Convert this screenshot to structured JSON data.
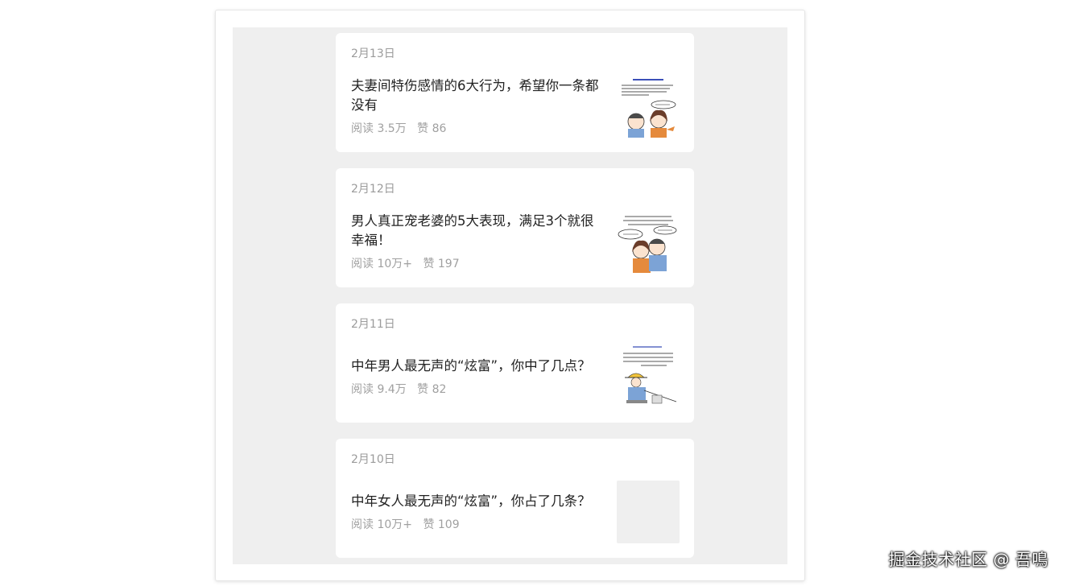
{
  "articles": [
    {
      "date": "2月13日",
      "title": "夫妻间特伤感情的6大行为，希望你一条都没有",
      "read": "阅读 3.5万",
      "likes": "赞 86",
      "thumbnail": "couple-cartoon"
    },
    {
      "date": "2月12日",
      "title": "男人真正宠老婆的5大表现，满足3个就很幸福！",
      "read": "阅读 10万+",
      "likes": "赞 197",
      "thumbnail": "hug-cartoon"
    },
    {
      "date": "2月11日",
      "title": "中年男人最无声的“炫富”，你中了几点？",
      "read": "阅读 9.4万",
      "likes": "赞 82",
      "thumbnail": "fishing-cartoon"
    },
    {
      "date": "2月10日",
      "title": "中年女人最无声的“炫富”，你占了几条？",
      "read": "阅读 10万+",
      "likes": "赞 109",
      "thumbnail": "placeholder"
    }
  ],
  "watermark": "掘金技术社区 @ 吾鳴"
}
